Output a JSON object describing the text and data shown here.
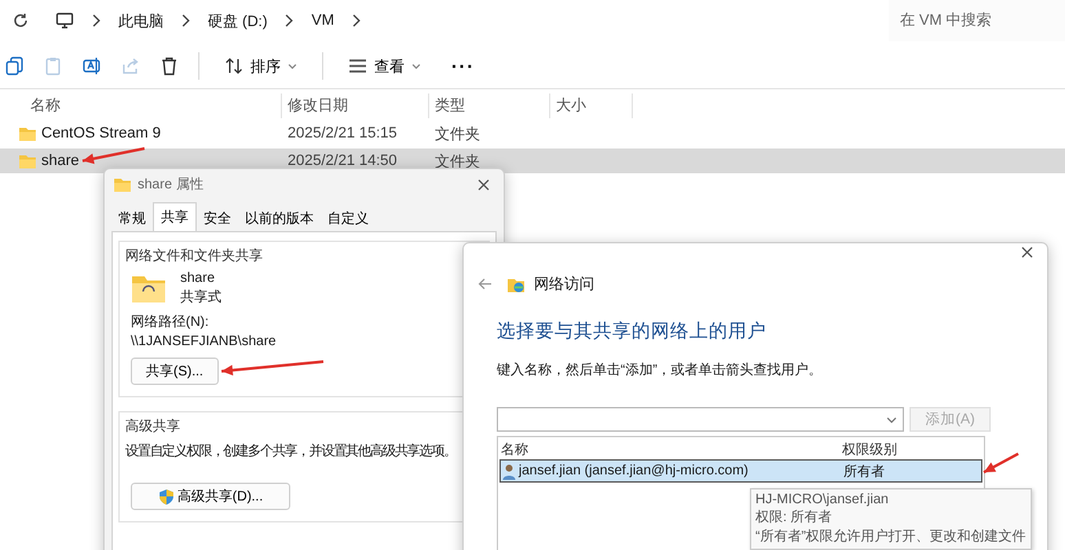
{
  "explorer": {
    "breadcrumb": [
      "此电脑",
      "硬盘 (D:)",
      "VM"
    ],
    "search": {
      "placeholder": "在 VM 中搜索"
    },
    "toolbar": [
      {
        "kind": "menu",
        "label": "排序"
      },
      {
        "kind": "menu",
        "label": "查看"
      },
      {
        "kind": "more",
        "label": "···"
      }
    ],
    "columns": [
      "名称",
      "修改日期",
      "类型",
      "大小"
    ],
    "rows": [
      {
        "name": "CentOS Stream 9",
        "modified": "2025/2/21 15:15",
        "type": "文件夹",
        "selected": false
      },
      {
        "name": "share",
        "modified": "2025/2/21 14:50",
        "type": "文件夹",
        "selected": true
      }
    ]
  },
  "properties_dialog": {
    "title": "share 属性",
    "tabs": [
      {
        "label": "常规",
        "selected": false
      },
      {
        "label": "共享",
        "selected": true
      },
      {
        "label": "安全",
        "selected": false
      },
      {
        "label": "以前的版本",
        "selected": false
      },
      {
        "label": "自定义",
        "selected": false
      }
    ],
    "network_sharing": {
      "title": "网络文件和文件夹共享",
      "folder": "share",
      "status": "共享式",
      "path_label": "网络路径(N):",
      "path": "\\\\1JANSEFJIANB\\share",
      "button": "共享(S)..."
    },
    "advanced_sharing": {
      "title": "高级共享",
      "description": "设置自定义权限，创建多个共享，并设置其他高级共享选项。",
      "button": "高级共享(D)..."
    }
  },
  "network_dialog": {
    "title": "网络访问",
    "heading": "选择要与其共享的网络上的用户",
    "instruction": "键入名称，然后单击“添加”，或者单击箭头查找用户。",
    "add_button": {
      "label": "添加(A)",
      "disabled": true
    },
    "columns": [
      "名称",
      "权限级别"
    ],
    "rows": [
      {
        "name": "jansef.jian (jansef.jian@hj-micro.com)",
        "permission": "所有者",
        "selected": true
      }
    ],
    "tooltip": [
      "HJ-MICRO\\jansef.jian",
      "权限: 所有者",
      "“所有者”权限允许用户打开、更改和创建文件"
    ]
  }
}
